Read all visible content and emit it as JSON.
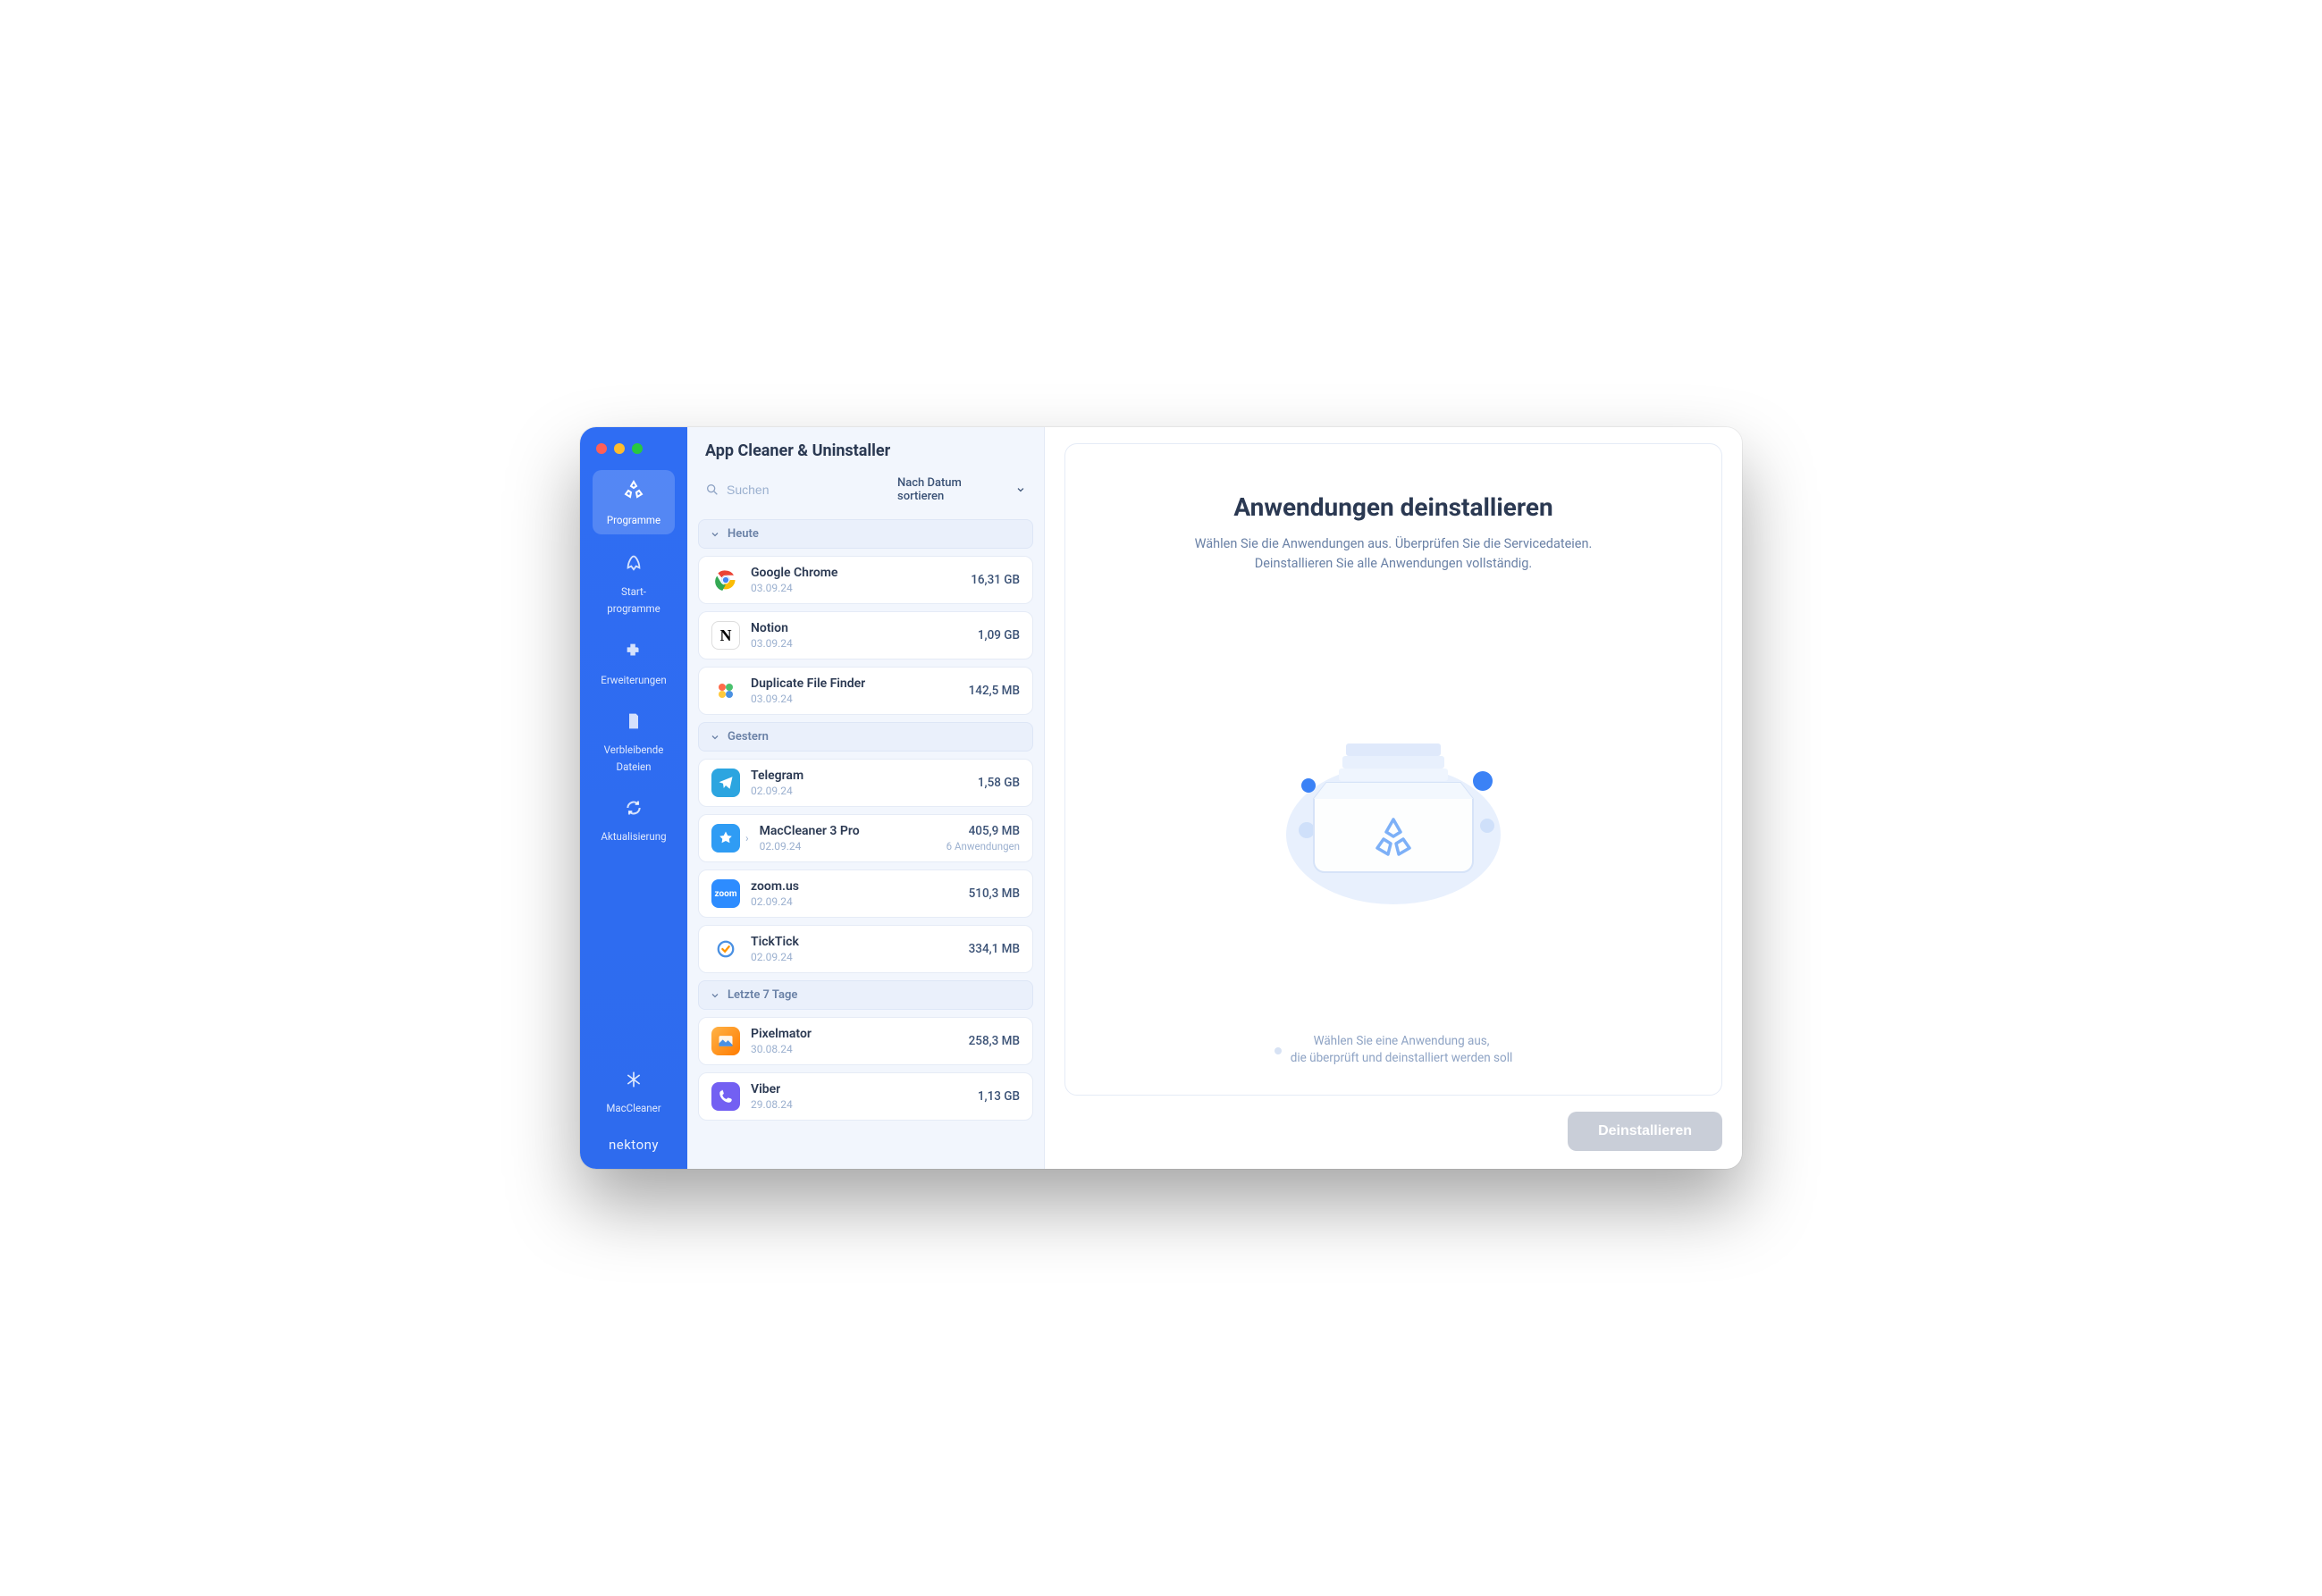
{
  "window": {
    "title": "App Cleaner & Uninstaller"
  },
  "sidebar": {
    "items": [
      {
        "label": "Programme"
      },
      {
        "label": "Start-\nprogramme"
      },
      {
        "label": "Erweiterungen"
      },
      {
        "label": "Verbleibende\nDateien"
      },
      {
        "label": "Aktualisierung"
      }
    ],
    "maccleaner_label": "MacCleaner",
    "brand": "nektony"
  },
  "search": {
    "placeholder": "Suchen"
  },
  "sort": {
    "label": "Nach Datum sortieren"
  },
  "groups": [
    {
      "label": "Heute",
      "apps": [
        {
          "name": "Google Chrome",
          "date": "03.09.24",
          "size": "16,31 GB",
          "icon": "chrome"
        },
        {
          "name": "Notion",
          "date": "03.09.24",
          "size": "1,09 GB",
          "icon": "notion"
        },
        {
          "name": "Duplicate File Finder",
          "date": "03.09.24",
          "size": "142,5 MB",
          "icon": "dff"
        }
      ]
    },
    {
      "label": "Gestern",
      "apps": [
        {
          "name": "Telegram",
          "date": "02.09.24",
          "size": "1,58 GB",
          "icon": "telegram"
        },
        {
          "name": "MacCleaner 3 Pro",
          "date": "02.09.24",
          "size": "405,9 MB",
          "sub": "6 Anwendungen",
          "icon": "mac",
          "expandable": true
        },
        {
          "name": "zoom.us",
          "date": "02.09.24",
          "size": "510,3 MB",
          "icon": "zoom"
        },
        {
          "name": "TickTick",
          "date": "02.09.24",
          "size": "334,1 MB",
          "icon": "tick"
        }
      ]
    },
    {
      "label": "Letzte 7 Tage",
      "apps": [
        {
          "name": "Pixelmator",
          "date": "30.08.24",
          "size": "258,3 MB",
          "icon": "pixel"
        },
        {
          "name": "Viber",
          "date": "29.08.24",
          "size": "1,13 GB",
          "icon": "viber"
        }
      ]
    }
  ],
  "detail": {
    "title": "Anwendungen deinstallieren",
    "desc_line1": "Wählen Sie die Anwendungen aus. Überprüfen Sie die Servicedateien.",
    "desc_line2": "Deinstallieren Sie alle Anwendungen vollständig.",
    "hint_line1": "Wählen Sie eine Anwendung aus,",
    "hint_line2": "die überprüft und deinstalliert werden soll",
    "uninstall_label": "Deinstallieren"
  }
}
